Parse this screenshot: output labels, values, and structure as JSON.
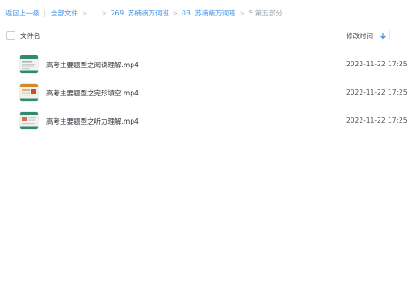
{
  "breadcrumb": {
    "back_label": "返回上一级",
    "root_label": "全部文件",
    "ellipsis": "...",
    "folder1": "269. 苏楠楠万词班",
    "folder2": "03. 苏楠楠万词班",
    "current": "5.第五部分",
    "separator": "|",
    "arrow": ">"
  },
  "header": {
    "name_label": "文件名",
    "time_label": "修改时间",
    "sort_icon": "sort-down-arrow-icon"
  },
  "files": [
    {
      "name": "高考主要题型之阅读理解.mp4",
      "modified": "2022-11-22 17:25",
      "icon": "video-thumbnail-icon",
      "accent": "#2e8b6e"
    },
    {
      "name": "高考主要题型之完形填空.mp4",
      "modified": "2022-11-22 17:25",
      "icon": "video-thumbnail-icon",
      "accent": "#d48a2a"
    },
    {
      "name": "高考主要题型之听力理解.mp4",
      "modified": "2022-11-22 17:25",
      "icon": "video-thumbnail-icon",
      "accent": "#2e8b6e"
    }
  ],
  "colors": {
    "link": "#3a8ee6",
    "muted": "#9aa3ad",
    "text": "#2a2f36"
  }
}
